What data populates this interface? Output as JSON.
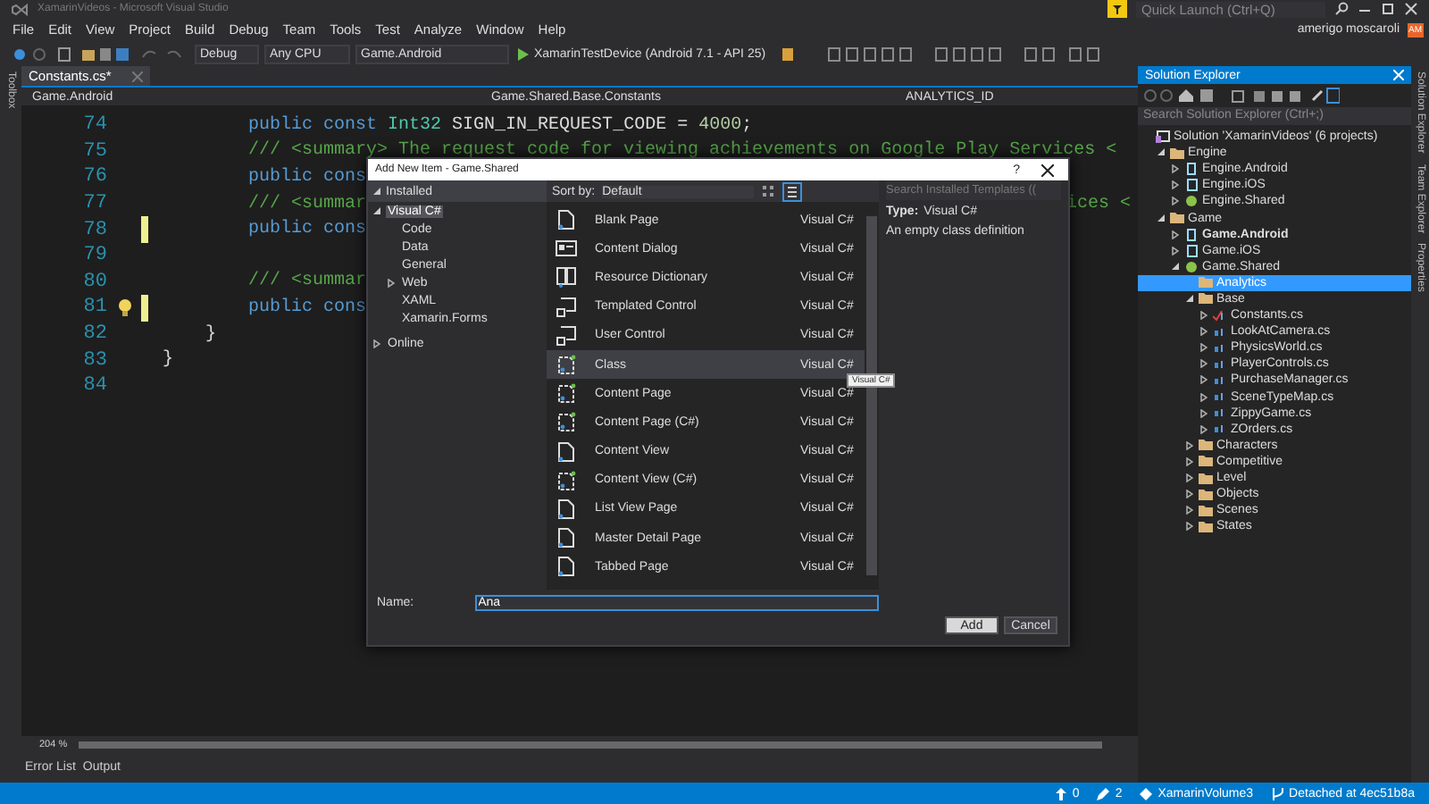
{
  "window": {
    "title": "XamarinVideos - Microsoft Visual Studio",
    "quick_launch": {
      "placeholder": "Quick Launch (Ctrl+Q)"
    }
  },
  "menu": [
    "File",
    "Edit",
    "View",
    "Project",
    "Build",
    "Debug",
    "Team",
    "Tools",
    "Test",
    "Analyze",
    "Window",
    "Help"
  ],
  "account": {
    "name": "amerigo moscaroli",
    "initials": "AM"
  },
  "toolbar": {
    "configuration": "Debug",
    "platform": "Any CPU",
    "startup_project": "Game.Android",
    "run_target": "XamarinTestDevice (Android 7.1 - API 25)"
  },
  "toolbox_tab": "Toolbox",
  "editor": {
    "tab": {
      "label": "Constants.cs*",
      "selected": true
    },
    "nav": {
      "project": "Game.Android",
      "type": "Game.Shared.Base.Constants",
      "member": "ANALYTICS_ID"
    },
    "lines": [
      {
        "number": "74",
        "changed": false,
        "lightbulb": false,
        "segments": [
          {
            "kind": "keyword",
            "text": "        public const "
          },
          {
            "kind": "type",
            "text": "Int32"
          },
          {
            "kind": "plain",
            "text": " SIGN_IN_REQUEST_CODE = "
          },
          {
            "kind": "number",
            "text": "4000"
          },
          {
            "kind": "plain",
            "text": ";"
          }
        ]
      },
      {
        "number": "75",
        "changed": false,
        "lightbulb": false,
        "segments": [
          {
            "kind": "comment",
            "text": "        /// <summary> The request code for viewing achievements on Google Play Services <"
          }
        ]
      },
      {
        "number": "76",
        "changed": false,
        "lightbulb": false,
        "segments": [
          {
            "kind": "keyword",
            "text": "        public cons"
          }
        ]
      },
      {
        "number": "77",
        "changed": false,
        "lightbulb": false,
        "segments": [
          {
            "kind": "comment",
            "text": "        /// <summar"
          }
        ],
        "right": "ices <"
      },
      {
        "number": "78",
        "changed": true,
        "lightbulb": false,
        "segments": [
          {
            "kind": "keyword",
            "text": "        public cons"
          }
        ]
      },
      {
        "number": "79",
        "changed": false,
        "lightbulb": false
      },
      {
        "number": "80",
        "changed": false,
        "lightbulb": false,
        "segments": [
          {
            "kind": "comment",
            "text": "        /// <summar"
          }
        ]
      },
      {
        "number": "81",
        "changed": true,
        "lightbulb": true,
        "segments": [
          {
            "kind": "keyword",
            "text": "        public cons"
          }
        ]
      },
      {
        "number": "82",
        "changed": false,
        "lightbulb": false,
        "segments": [
          {
            "kind": "plain",
            "text": "    }"
          }
        ]
      },
      {
        "number": "83",
        "changed": false,
        "lightbulb": false,
        "segments": [
          {
            "kind": "plain",
            "text": "}"
          }
        ]
      },
      {
        "number": "84",
        "changed": false,
        "lightbulb": false
      }
    ],
    "zoom": "204 %"
  },
  "bottom_tabs": [
    "Error List",
    "Output"
  ],
  "dialog": {
    "title": "Add New Item - Game.Shared",
    "help": "?",
    "categories_header": "Installed",
    "categories": [
      {
        "label": "Visual C#",
        "selected": true,
        "expanded": true,
        "children": [
          {
            "label": "Code",
            "selected": false
          },
          {
            "label": "Data",
            "selected": false
          },
          {
            "label": "General",
            "selected": false
          },
          {
            "label": "Web",
            "selected": false,
            "expanded": false
          },
          {
            "label": "XAML",
            "selected": false
          },
          {
            "label": "Xamarin.Forms",
            "selected": false
          }
        ]
      },
      {
        "label": "Online",
        "selected": false,
        "expanded": false
      }
    ],
    "sort_label": "Sort by:",
    "sort_value": "Default",
    "search": {
      "placeholder": "Search Installed Templates (("
    },
    "templates": [
      {
        "name": "Blank Page",
        "language": "Visual C#",
        "kind": "page",
        "selected": false
      },
      {
        "name": "Content Dialog",
        "language": "Visual C#",
        "kind": "dialog",
        "selected": false
      },
      {
        "name": "Resource Dictionary",
        "language": "Visual C#",
        "kind": "dictionary",
        "selected": false
      },
      {
        "name": "Templated Control",
        "language": "Visual C#",
        "kind": "control",
        "selected": false
      },
      {
        "name": "User Control",
        "language": "Visual C#",
        "kind": "control",
        "selected": false
      },
      {
        "name": "Class",
        "language": "Visual C#",
        "kind": "class",
        "selected": true
      },
      {
        "name": "Content Page",
        "language": "Visual C#",
        "kind": "class",
        "selected": false
      },
      {
        "name": "Content Page (C#)",
        "language": "Visual C#",
        "kind": "class",
        "selected": false
      },
      {
        "name": "Content View",
        "language": "Visual C#",
        "kind": "page",
        "selected": false
      },
      {
        "name": "Content View (C#)",
        "language": "Visual C#",
        "kind": "class",
        "selected": false
      },
      {
        "name": "List View Page",
        "language": "Visual C#",
        "kind": "page",
        "selected": false
      },
      {
        "name": "Master Detail Page",
        "language": "Visual C#",
        "kind": "page",
        "selected": false
      },
      {
        "name": "Tabbed Page",
        "language": "Visual C#",
        "kind": "page",
        "selected": false
      }
    ],
    "tooltip": "Visual C#",
    "type_label": "Type:",
    "type_value": "Visual C#",
    "description": "An empty class definition",
    "name_label": "Name:",
    "name_value": "Ana",
    "buttons": [
      "Add",
      "Cancel"
    ]
  },
  "solution_explorer": {
    "title": "Solution Explorer",
    "search": {
      "placeholder": "Search Solution Explorer (Ctrl+;)"
    },
    "tree": [
      {
        "label": "Solution 'XamarinVideos' (6 projects)",
        "kind": "solution",
        "selected": false,
        "children": [
          {
            "label": "Engine",
            "kind": "folder",
            "expanded": true,
            "selected": false,
            "children": [
              {
                "label": "Engine.Android",
                "kind": "android",
                "startup": false,
                "expanded": false,
                "selected": false
              },
              {
                "label": "Engine.iOS",
                "kind": "ios",
                "startup": false,
                "expanded": false,
                "selected": false
              },
              {
                "label": "Engine.Shared",
                "kind": "shared",
                "startup": false,
                "expanded": false,
                "selected": false
              }
            ]
          },
          {
            "label": "Game",
            "kind": "folder",
            "expanded": true,
            "selected": false,
            "children": [
              {
                "label": "Game.Android",
                "kind": "android",
                "startup": true,
                "expanded": false,
                "selected": false
              },
              {
                "label": "Game.iOS",
                "kind": "ios",
                "startup": false,
                "expanded": false,
                "selected": false
              },
              {
                "label": "Game.Shared",
                "kind": "shared",
                "startup": false,
                "expanded": true,
                "selected": false,
                "children": [
                  {
                    "label": "Analytics",
                    "kind": "folder",
                    "selected": true
                  },
                  {
                    "label": "Base",
                    "kind": "folder",
                    "expanded": true,
                    "selected": false,
                    "children": [
                      {
                        "label": "Constants.cs",
                        "kind": "cs",
                        "modified": true,
                        "expanded": false,
                        "selected": false
                      },
                      {
                        "label": "LookAtCamera.cs",
                        "kind": "cs",
                        "modified": false,
                        "expanded": false,
                        "selected": false
                      },
                      {
                        "label": "PhysicsWorld.cs",
                        "kind": "cs",
                        "modified": false,
                        "expanded": false,
                        "selected": false
                      },
                      {
                        "label": "PlayerControls.cs",
                        "kind": "cs",
                        "modified": false,
                        "expanded": false,
                        "selected": false
                      },
                      {
                        "label": "PurchaseManager.cs",
                        "kind": "cs",
                        "modified": false,
                        "expanded": false,
                        "selected": false
                      },
                      {
                        "label": "SceneTypeMap.cs",
                        "kind": "cs",
                        "modified": false,
                        "expanded": false,
                        "selected": false
                      },
                      {
                        "label": "ZippyGame.cs",
                        "kind": "cs",
                        "modified": false,
                        "expanded": false,
                        "selected": false
                      },
                      {
                        "label": "ZOrders.cs",
                        "kind": "cs",
                        "modified": false,
                        "expanded": false,
                        "selected": false
                      }
                    ]
                  },
                  {
                    "label": "Characters",
                    "kind": "folder",
                    "expanded": false,
                    "selected": false
                  },
                  {
                    "label": "Competitive",
                    "kind": "folder",
                    "expanded": false,
                    "selected": false
                  },
                  {
                    "label": "Level",
                    "kind": "folder",
                    "expanded": false,
                    "selected": false
                  },
                  {
                    "label": "Objects",
                    "kind": "folder",
                    "expanded": false,
                    "selected": false
                  },
                  {
                    "label": "Scenes",
                    "kind": "folder",
                    "expanded": false,
                    "selected": false
                  },
                  {
                    "label": "States",
                    "kind": "folder",
                    "expanded": false,
                    "selected": false
                  }
                ]
              }
            ]
          }
        ]
      }
    ]
  },
  "side_tabs": [
    "Solution Explorer",
    "Team Explorer",
    "Properties"
  ],
  "status_bar": {
    "up": "0",
    "edits": "2",
    "repo": "XamarinVolume3",
    "branch": "Detached at 4ec51b8a"
  }
}
